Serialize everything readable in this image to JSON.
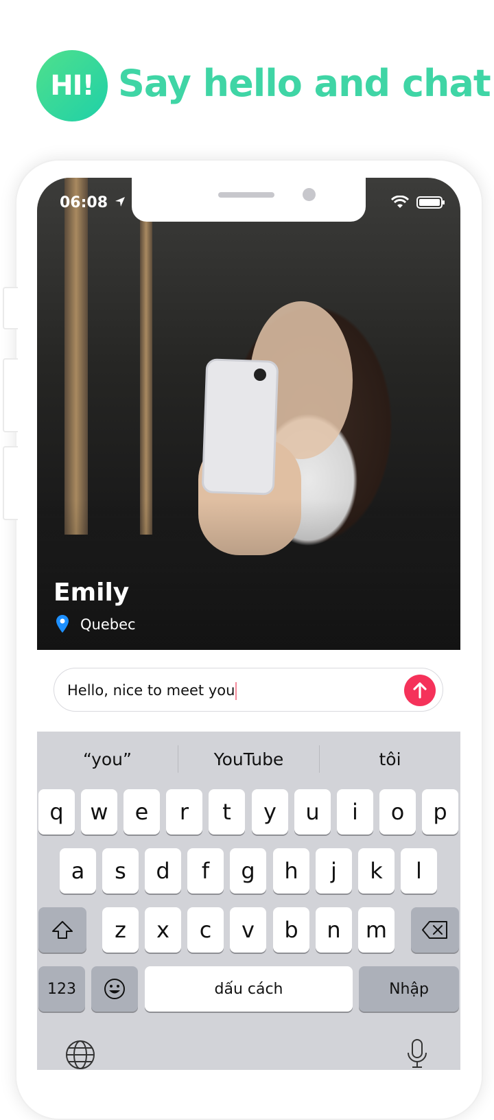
{
  "header": {
    "badge": "HI!",
    "headline": "Say hello and chat"
  },
  "status_bar": {
    "time": "06:08"
  },
  "profile": {
    "name": "Emily",
    "location": "Quebec"
  },
  "message_input": {
    "value": "Hello, nice to meet you"
  },
  "keyboard": {
    "suggestions": [
      "“you”",
      "YouTube",
      "tôi"
    ],
    "row1": [
      "q",
      "w",
      "e",
      "r",
      "t",
      "y",
      "u",
      "i",
      "o",
      "p"
    ],
    "row2": [
      "a",
      "s",
      "d",
      "f",
      "g",
      "h",
      "j",
      "k",
      "l"
    ],
    "row3": [
      "z",
      "x",
      "c",
      "v",
      "b",
      "n",
      "m"
    ],
    "numbers_label": "123",
    "space_label": "dấu cách",
    "return_label": "Nhập"
  },
  "colors": {
    "accent_green": "#3fd5a5",
    "send_red": "#f5325a"
  },
  "icons": [
    "location-pin-icon",
    "send-arrow-icon",
    "shift-icon",
    "backspace-icon",
    "emoji-icon",
    "globe-icon",
    "microphone-icon",
    "wifi-icon",
    "battery-icon"
  ]
}
